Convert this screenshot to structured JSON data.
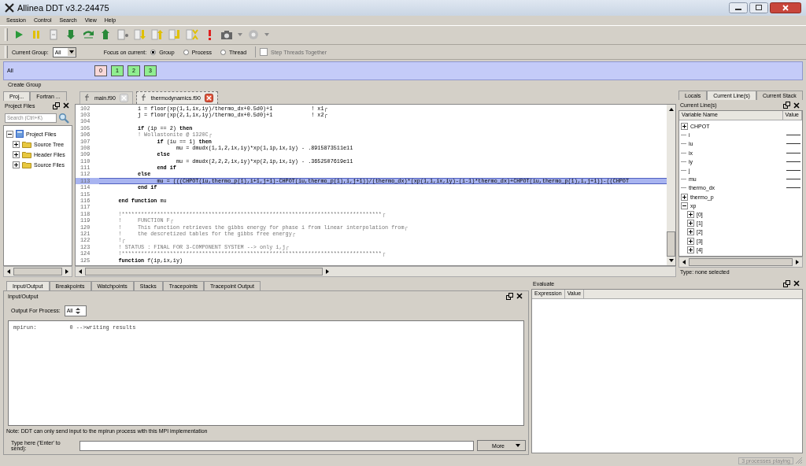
{
  "window": {
    "title": "Allinea DDT v3.2-24475"
  },
  "menu": [
    "Session",
    "Control",
    "Search",
    "View",
    "Help"
  ],
  "group_bar": {
    "current_group_label": "Current Group:",
    "current_group": "All",
    "focus_label": "Focus on current:",
    "focus_options": [
      {
        "label": "Group",
        "selected": true
      },
      {
        "label": "Process",
        "selected": false
      },
      {
        "label": "Thread",
        "selected": false
      }
    ],
    "step_threads": {
      "label": "Step Threads Together",
      "checked": false,
      "disabled": true
    }
  },
  "process_groups": [
    {
      "name": "All",
      "processes": [
        {
          "label": "0",
          "color": "#f8d8d8"
        },
        {
          "label": "1",
          "color": "#90ee90"
        },
        {
          "label": "2",
          "color": "#90ee90"
        },
        {
          "label": "3",
          "color": "#90ee90"
        }
      ]
    }
  ],
  "create_group": "Create Group",
  "project_panel": {
    "tabs": [
      {
        "label": "Proj...",
        "selected": true
      },
      {
        "label": "Fortran ...",
        "selected": false
      }
    ],
    "title": "Project Files",
    "search": {
      "placeholder": "Search (Ctrl+K)"
    },
    "tree": [
      {
        "label": "Project Files",
        "expanded": true,
        "children": [
          {
            "label": "Source Tree",
            "expanded": false
          },
          {
            "label": "Header Files",
            "expanded": false
          },
          {
            "label": "Source Files",
            "expanded": false
          }
        ]
      }
    ]
  },
  "editor": {
    "tabs": [
      {
        "label": "main.f90",
        "selected": false
      },
      {
        "label": "thermodynamics.f90",
        "selected": true
      }
    ],
    "lines": [
      {
        "number": "102",
        "kind": "code",
        "selected": false,
        "text": "\t\ti = floor(xp(1,1,ix,iy)/thermo_dx+0.5d0)+1\t\t! x1┌"
      },
      {
        "number": "103",
        "kind": "code",
        "selected": false,
        "text": "\t\tj = floor(xp(2,1,ix,iy)/thermo_dx+0.5d0)+1\t\t! x2┌"
      },
      {
        "number": "104",
        "kind": "code",
        "selected": false
      },
      {
        "number": "105",
        "kind": "code",
        "selected": false,
        "text": "\t\t**if** (ip == 2) **then**"
      },
      {
        "number": "106",
        "kind": "comment",
        "selected": false,
        "text": "\t\t! Wollastonite @ 1320C┌"
      },
      {
        "number": "107",
        "kind": "code",
        "selected": false,
        "text": "\t\t\t**if** (iu == 1) **then**"
      },
      {
        "number": "108",
        "kind": "code",
        "selected": false,
        "text": "\t\t\t\tmu = dmudx(1,1,2,ix,iy)*xp(1,ip,ix,iy) - .8915873511e11"
      },
      {
        "number": "109",
        "kind": "code",
        "selected": false,
        "text": "\t\t\t**else**"
      },
      {
        "number": "110",
        "kind": "code",
        "selected": false,
        "text": "\t\t\t\tmu = dmudx(2,2,2,ix,iy)*xp(2,ip,ix,iy) - .3652507619e11"
      },
      {
        "number": "111",
        "kind": "code",
        "selected": false,
        "text": "\t\t\t**end if**"
      },
      {
        "number": "112",
        "kind": "code",
        "selected": false,
        "text": "\t\t**else**"
      },
      {
        "number": "113",
        "kind": "code",
        "selected": true,
        "text": "\t\t\tmu = (((CHPOT(iu,thermo_p(1),i+1,j+1)-CHPOT(iu,thermo_p(1),i,j+1))/(thermo_dx)*(xp(1,1,ix,iy)-(i-1)*thermo_dx)+CHPOT(iu,thermo_p(1),i,j+1))-((CHPOT"
      },
      {
        "number": "114",
        "kind": "code",
        "selected": false,
        "text": "\t\t**end if**"
      },
      {
        "number": "115",
        "kind": "code",
        "selected": false
      },
      {
        "number": "116",
        "kind": "code",
        "selected": false,
        "text": "\t**end function** mu"
      },
      {
        "number": "117",
        "kind": "code",
        "selected": false
      },
      {
        "number": "118",
        "kind": "comment",
        "selected": false,
        "text": "\t!*********************************************************************************┌"
      },
      {
        "number": "119",
        "kind": "comment",
        "selected": false,
        "text": "\t!\tFUNCTION F┌"
      },
      {
        "number": "120",
        "kind": "comment",
        "selected": false,
        "text": "\t!\tThis function retrieves the gibbs energy for phase i from linear interpolation from┌"
      },
      {
        "number": "121",
        "kind": "comment",
        "selected": false,
        "text": "\t!\tthe descretized tables for the gibbs free energy┌"
      },
      {
        "number": "122",
        "kind": "comment",
        "selected": false,
        "text": "\t!┌"
      },
      {
        "number": "123",
        "kind": "comment",
        "selected": false,
        "text": "\t! STATUS : FINAL FOR 3-COMPONENT SYSTEM --> only i,j┌"
      },
      {
        "number": "124",
        "kind": "comment",
        "selected": false,
        "text": "\t!*********************************************************************************┌"
      },
      {
        "number": "125",
        "kind": "code",
        "selected": false,
        "text": "\t**function** f(ip,ix,iy)"
      }
    ]
  },
  "variables_panel": {
    "tabs": [
      {
        "label": "Locals",
        "selected": false
      },
      {
        "label": "Current Line(s)",
        "selected": true
      },
      {
        "label": "Current Stack",
        "selected": false
      }
    ],
    "title": "Current Line(s)",
    "columns": [
      "Variable Name",
      "Value"
    ],
    "tree": [
      {
        "label": "CHPOT",
        "expanded": false
      },
      {
        "label": "i"
      },
      {
        "label": "iu"
      },
      {
        "label": "ix"
      },
      {
        "label": "iy"
      },
      {
        "label": "j"
      },
      {
        "label": "mu"
      },
      {
        "label": "thermo_dx"
      },
      {
        "label": "thermo_p",
        "expanded": false
      },
      {
        "label": "xp",
        "expanded": true,
        "children": [
          {
            "label": "[0]",
            "expanded": false
          },
          {
            "label": "[1]",
            "expanded": false
          },
          {
            "label": "[2]",
            "expanded": false
          },
          {
            "label": "[3]",
            "expanded": false
          },
          {
            "label": "[4]",
            "expanded": false
          }
        ]
      }
    ],
    "type_info": "Type: none selected"
  },
  "io_panel": {
    "tabs": [
      {
        "label": "Input/Output",
        "selected": true
      },
      {
        "label": "Breakpoints",
        "selected": false
      },
      {
        "label": "Watchpoints",
        "selected": false
      },
      {
        "label": "Stacks",
        "selected": false
      },
      {
        "label": "Tracepoints",
        "selected": false
      },
      {
        "label": "Tracepoint Output",
        "selected": false
      }
    ],
    "title": "Input/Output",
    "output_process_label": "Output For Process:",
    "output_process": "All",
    "output": [
      "mpirun:          0 -->writing results"
    ],
    "note": "Note: DDT can only send input to the mpirun process with this MPI implementation",
    "input_label": "Type here ('Enter' to send):",
    "more_button": "More"
  },
  "evaluate_panel": {
    "title": "Evaluate",
    "columns": [
      "Expression",
      "Value"
    ]
  },
  "status_bar": {
    "text": "3 processes playing"
  }
}
